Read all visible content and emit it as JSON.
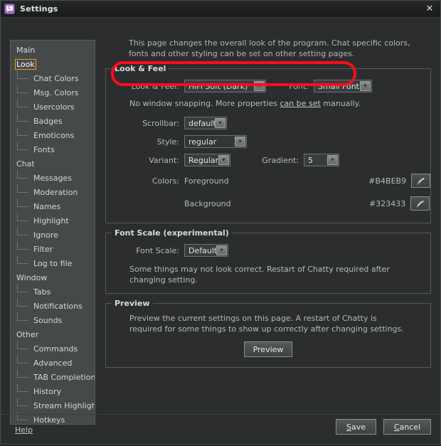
{
  "window": {
    "title": "Settings",
    "app_icon": "chatty-logo-icon",
    "icon_letter": "C",
    "close_label": "✕"
  },
  "sidebar": {
    "items": [
      {
        "label": "Main",
        "level": 0,
        "selected": false,
        "last": false
      },
      {
        "label": "Look",
        "level": 0,
        "selected": true,
        "last": false
      },
      {
        "label": "Chat Colors",
        "level": 1,
        "selected": false,
        "last": false
      },
      {
        "label": "Msg. Colors",
        "level": 1,
        "selected": false,
        "last": false
      },
      {
        "label": "Usercolors",
        "level": 1,
        "selected": false,
        "last": false
      },
      {
        "label": "Badges",
        "level": 1,
        "selected": false,
        "last": false
      },
      {
        "label": "Emoticons",
        "level": 1,
        "selected": false,
        "last": false
      },
      {
        "label": "Fonts",
        "level": 1,
        "selected": false,
        "last": true
      },
      {
        "label": "Chat",
        "level": 0,
        "selected": false,
        "last": false
      },
      {
        "label": "Messages",
        "level": 1,
        "selected": false,
        "last": false
      },
      {
        "label": "Moderation",
        "level": 1,
        "selected": false,
        "last": false
      },
      {
        "label": "Names",
        "level": 1,
        "selected": false,
        "last": false
      },
      {
        "label": "Highlight",
        "level": 1,
        "selected": false,
        "last": false
      },
      {
        "label": "Ignore",
        "level": 1,
        "selected": false,
        "last": false
      },
      {
        "label": "Filter",
        "level": 1,
        "selected": false,
        "last": false
      },
      {
        "label": "Log to file",
        "level": 1,
        "selected": false,
        "last": true
      },
      {
        "label": "Window",
        "level": 0,
        "selected": false,
        "last": false
      },
      {
        "label": "Tabs",
        "level": 1,
        "selected": false,
        "last": false
      },
      {
        "label": "Notifications",
        "level": 1,
        "selected": false,
        "last": false
      },
      {
        "label": "Sounds",
        "level": 1,
        "selected": false,
        "last": true
      },
      {
        "label": "Other",
        "level": 0,
        "selected": false,
        "last": false
      },
      {
        "label": "Commands",
        "level": 1,
        "selected": false,
        "last": false
      },
      {
        "label": "Advanced",
        "level": 1,
        "selected": false,
        "last": false
      },
      {
        "label": "TAB Completion",
        "level": 1,
        "selected": false,
        "last": false
      },
      {
        "label": "History",
        "level": 1,
        "selected": false,
        "last": false
      },
      {
        "label": "Stream Highlights",
        "level": 1,
        "selected": false,
        "last": false
      },
      {
        "label": "Hotkeys",
        "level": 1,
        "selected": false,
        "last": true
      }
    ]
  },
  "main": {
    "description": "This page changes the overall look of the program. Chat specific colors, fonts and other styling can be set on other setting pages.",
    "look_and_feel": {
      "title": "Look & Feel",
      "lnf_label": "Look & Feel:",
      "lnf_value": "HiFi Soft (Dark)",
      "font_label": "Font:",
      "font_value": "Small Font",
      "note_prefix": "No window snapping. More properties ",
      "note_link": "can be set",
      "note_suffix": " manually.",
      "scrollbar_label": "Scrollbar:",
      "scrollbar_value": "default",
      "style_label": "Style:",
      "style_value": "regular",
      "variant_label": "Variant:",
      "variant_value": "Regular",
      "gradient_label": "Gradient:",
      "gradient_value": "5",
      "colors_label": "Colors:",
      "foreground_label": "Foreground",
      "foreground_hex": "#B4BEB9",
      "background_label": "Background",
      "background_hex": "#323433",
      "picker_icon": "eyedropper-icon"
    },
    "font_scale": {
      "title": "Font Scale (experimental)",
      "label": "Font Scale:",
      "value": "Default",
      "note": "Some things may not look correct. Restart of Chatty required after changing setting."
    },
    "preview": {
      "title": "Preview",
      "note": "Preview the current settings on this page. A restart of Chatty is required for some things to show up correctly after changing settings.",
      "button": "Preview"
    }
  },
  "footer": {
    "help_label": "Help",
    "save_mnemonic": "S",
    "save_rest": "ave",
    "cancel_mnemonic": "C",
    "cancel_rest": "ancel"
  },
  "annotation": {
    "color": "#FC0D1B",
    "shape": "rounded-rectangle-highlight"
  },
  "icons": {
    "chevron_down": "▾"
  }
}
